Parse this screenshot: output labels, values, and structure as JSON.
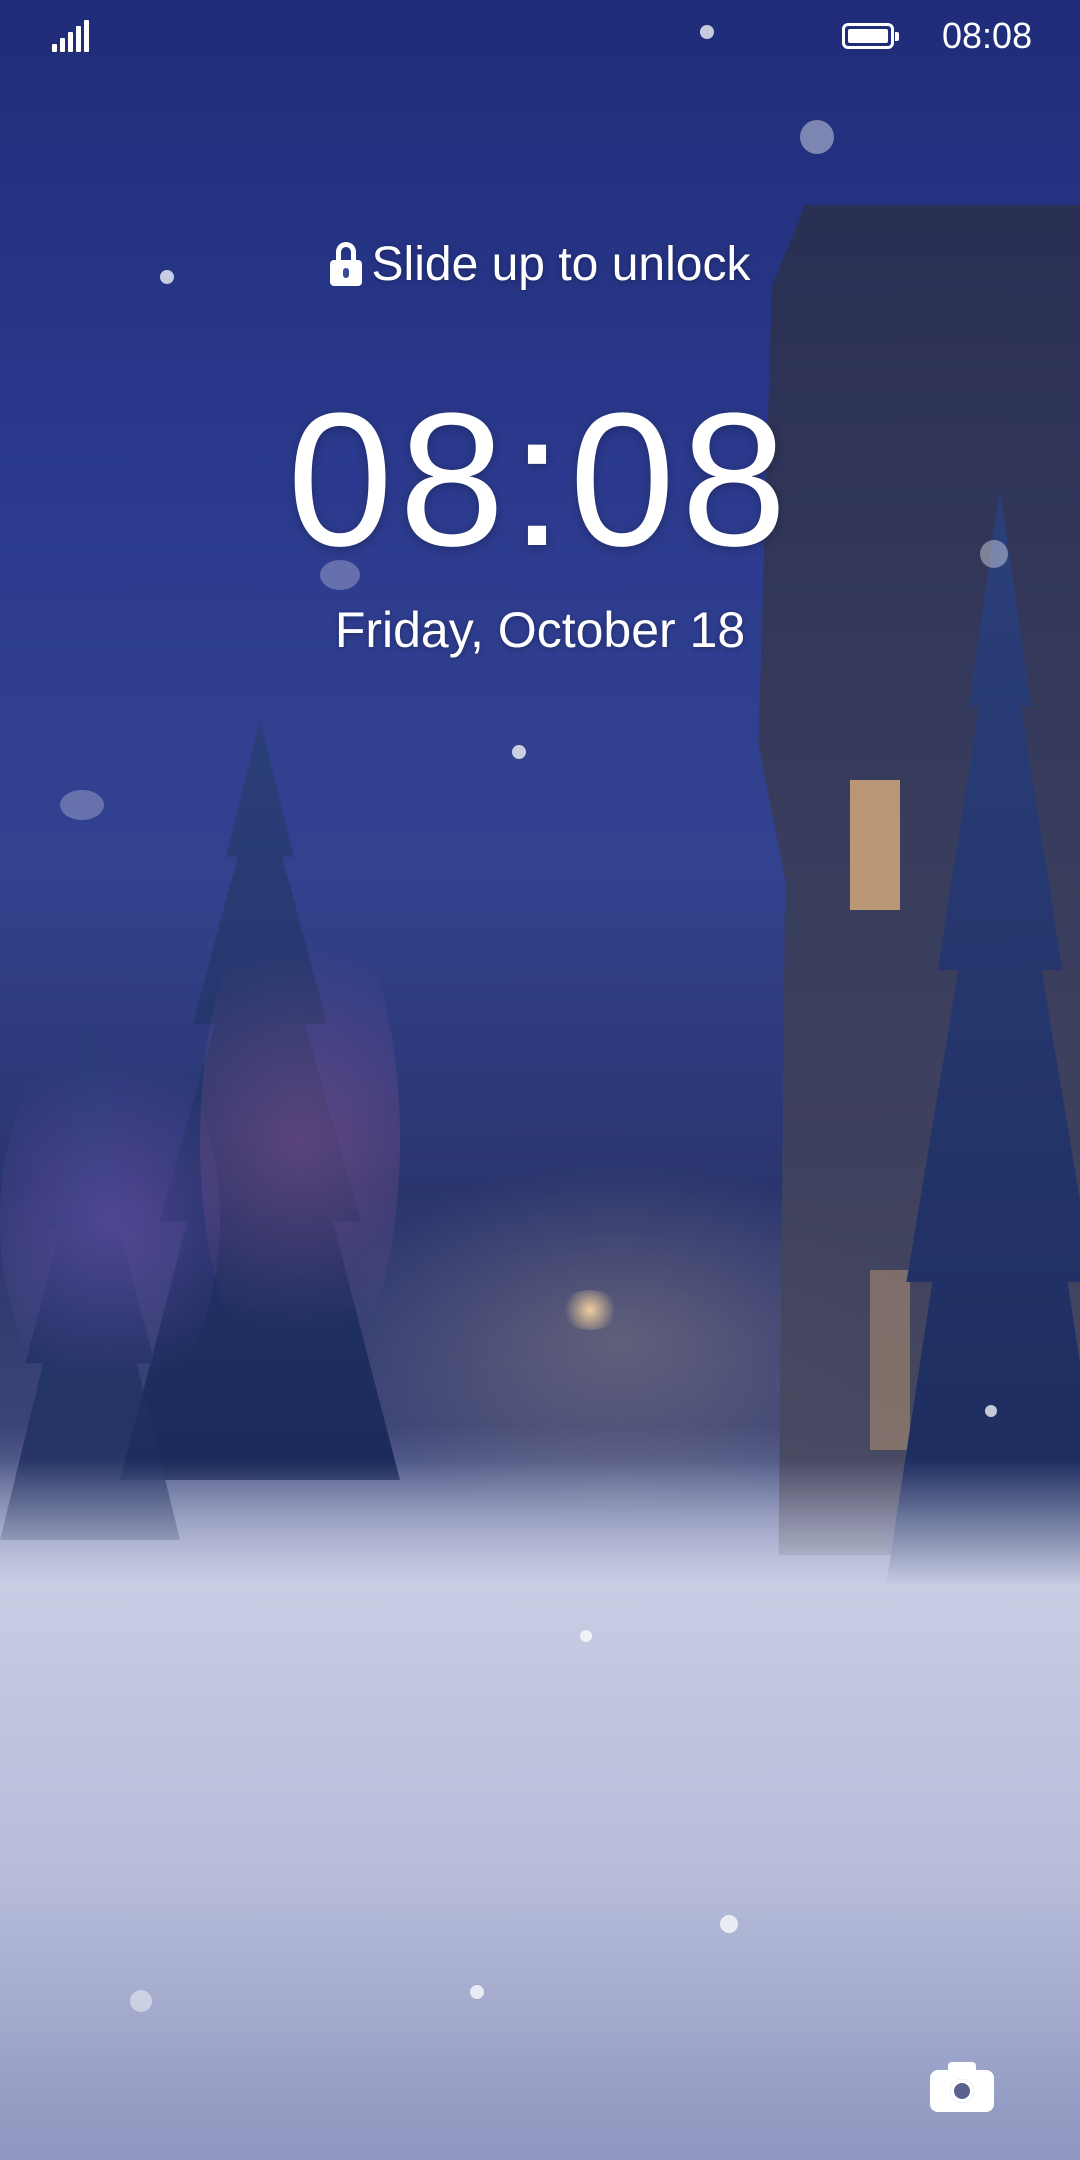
{
  "status_bar": {
    "signal_icon": "signal-icon",
    "battery_icon": "battery-icon",
    "battery_level": 1.0,
    "time": "08:08"
  },
  "lock_screen": {
    "unlock_hint": "Slide up to unlock",
    "lock_icon": "lock-icon",
    "clock": "08:08",
    "date": "Friday, October 18",
    "camera_icon": "camera-icon"
  },
  "colors": {
    "sky": "#2b3a8e",
    "snow": "#c8cde4",
    "text": "#ffffff"
  }
}
